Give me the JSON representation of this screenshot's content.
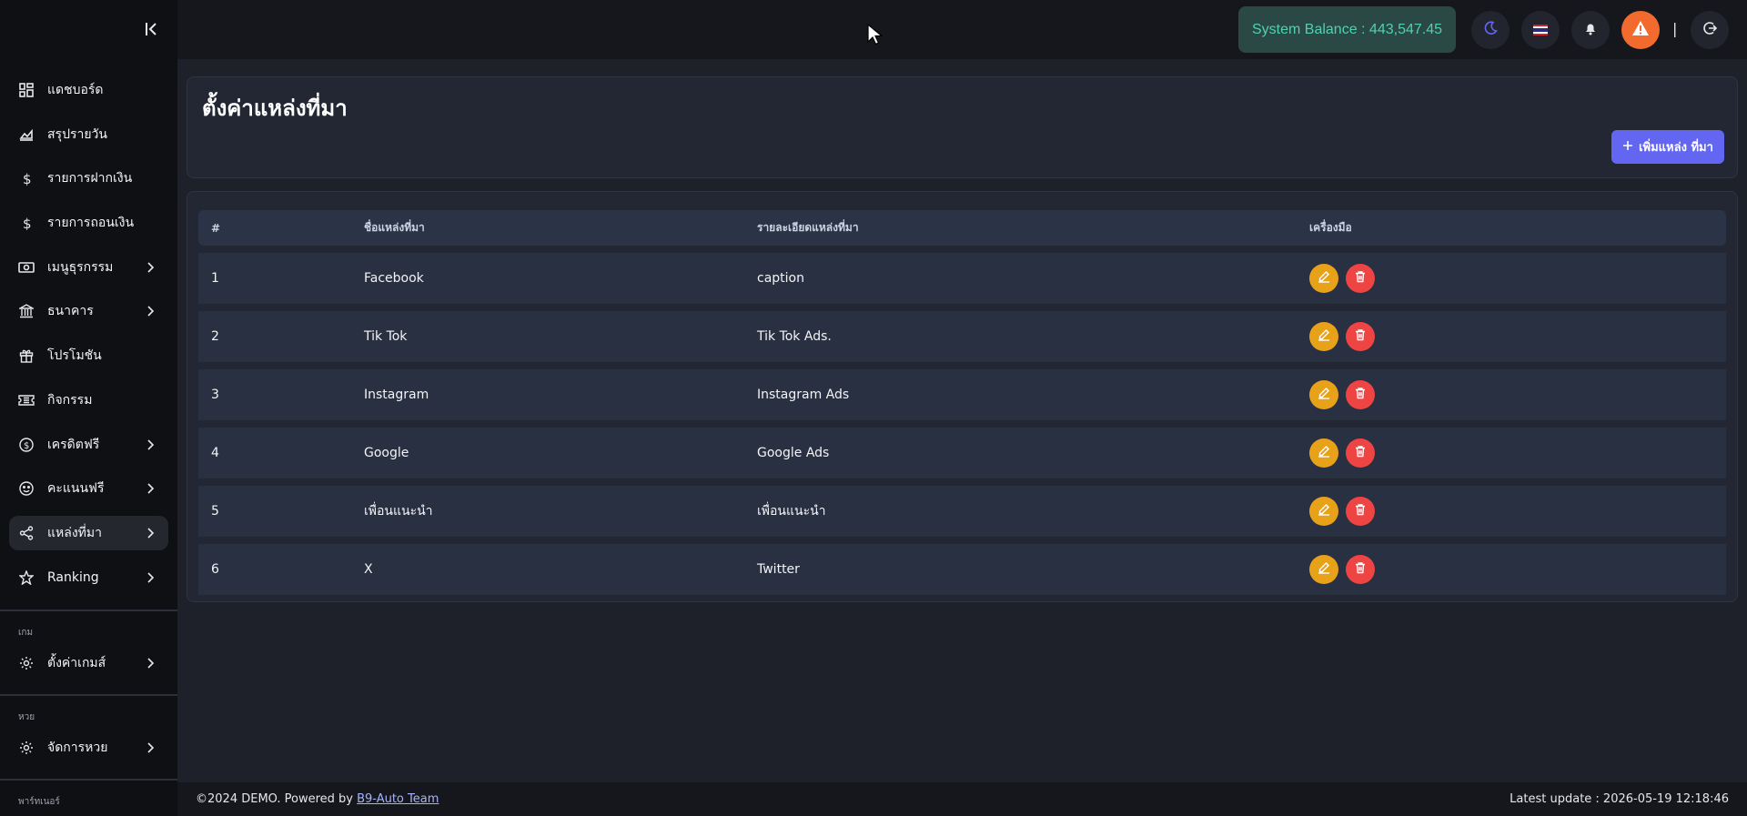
{
  "sidebar": {
    "items": [
      {
        "label": "แดชบอร์ด",
        "icon": "dashboard-icon",
        "chevron": false
      },
      {
        "label": "สรุปรายวัน",
        "icon": "chart-area-icon",
        "chevron": false
      },
      {
        "label": "รายการฝากเงิน",
        "icon": "dollar-icon",
        "chevron": false
      },
      {
        "label": "รายการถอนเงิน",
        "icon": "dollar-icon",
        "chevron": false
      },
      {
        "label": "เมนูธุรกรรม",
        "icon": "money-bill-icon",
        "chevron": true
      },
      {
        "label": "ธนาคาร",
        "icon": "bank-icon",
        "chevron": true
      },
      {
        "label": "โปรโมชัน",
        "icon": "gift-icon",
        "chevron": false
      },
      {
        "label": "กิจกรรม",
        "icon": "ticket-icon",
        "chevron": false
      },
      {
        "label": "เครดิตฟรี",
        "icon": "coin-icon",
        "chevron": true
      },
      {
        "label": "คะแนนฟรี",
        "icon": "smile-icon",
        "chevron": true
      },
      {
        "label": "แหล่งที่มา",
        "icon": "share-icon",
        "chevron": true
      },
      {
        "label": "Ranking",
        "icon": "star-icon",
        "chevron": true
      }
    ],
    "game_section": "เกม",
    "game_item": "ตั้งค่าเกมส์",
    "lotto_section": "หวย",
    "lotto_item": "จัดการหวย",
    "partner_section": "พาร์ทเนอร์"
  },
  "header": {
    "balance": "System Balance : 443,547.45",
    "separator": "|"
  },
  "page": {
    "title": "ตั้งค่าแหล่งที่มา",
    "add_button": "เพิ่มแหล่ง ที่มา"
  },
  "table": {
    "headers": [
      "#",
      "ชื่อแหล่งที่มา",
      "รายละเอียดแหล่งที่มา",
      "เครื่องมือ"
    ],
    "rows": [
      {
        "no": "1",
        "name": "Facebook",
        "detail": "caption"
      },
      {
        "no": "2",
        "name": "Tik Tok",
        "detail": "Tik Tok Ads."
      },
      {
        "no": "3",
        "name": "Instagram",
        "detail": "Instagram Ads"
      },
      {
        "no": "4",
        "name": "Google",
        "detail": "Google Ads"
      },
      {
        "no": "5",
        "name": "เพื่อนแนะนำ",
        "detail": "เพื่อนแนะนำ"
      },
      {
        "no": "6",
        "name": "X",
        "detail": "Twitter"
      }
    ]
  },
  "footer": {
    "copyright_prefix": "©2024 DEMO. Powered by ",
    "link_brand": "B9-Auto",
    "link_team": " Team",
    "last_update": "Latest update : 2026-05-19 12:18:46"
  },
  "colors": {
    "accent": "#6366f1",
    "balance_text": "#4fd1b0",
    "edit": "#e8a21a",
    "delete": "#ef4444",
    "alert": "#f26a2d"
  }
}
